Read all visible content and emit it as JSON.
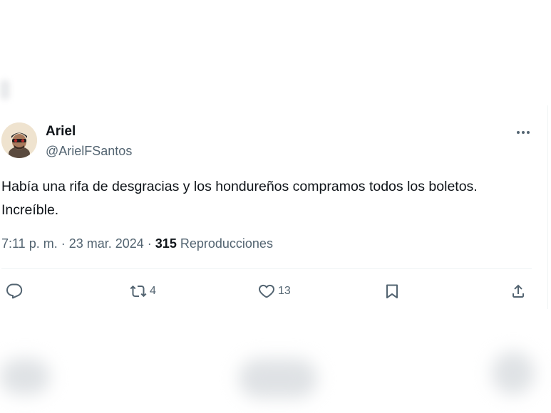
{
  "tweet": {
    "author_name": "Ariel",
    "author_handle": "@ArielFSantos",
    "text": "Había una rifa de desgracias y los hondureños compramos todos los boletos. Increíble.",
    "time": "7:11 p. m.",
    "separator": " · ",
    "date": "23 mar. 2024",
    "views_count": "315",
    "views_label": "Reproducciones"
  },
  "actions": {
    "reply_icon": "reply-icon",
    "retweet_icon": "retweet-icon",
    "retweet_count": "4",
    "like_icon": "heart-icon",
    "like_count": "13",
    "bookmark_icon": "bookmark-icon",
    "share_icon": "share-icon"
  },
  "colors": {
    "text_primary": "#0f1419",
    "text_secondary": "#536471",
    "divider": "#eff3f4"
  }
}
